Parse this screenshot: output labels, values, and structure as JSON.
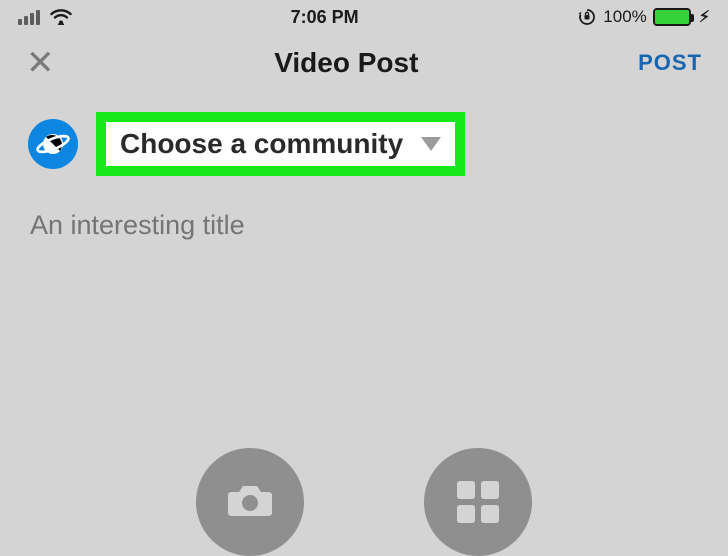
{
  "status": {
    "time": "7:06 PM",
    "battery_pct": "100%"
  },
  "nav": {
    "title": "Video Post",
    "post_label": "POST"
  },
  "community": {
    "label": "Choose a community"
  },
  "title_input": {
    "placeholder": "An interesting title"
  }
}
